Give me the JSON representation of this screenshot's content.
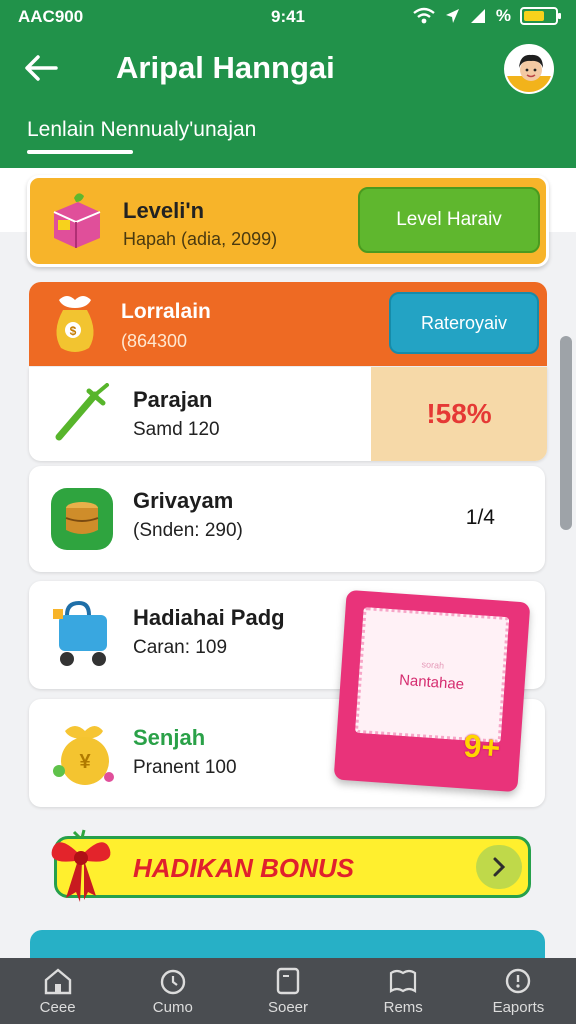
{
  "status_bar": {
    "carrier": "AAC900",
    "time": "9:41",
    "battery_pct": "%"
  },
  "header": {
    "title": "Aripal Hanngai",
    "subtab": "Lenlain Nennualy'unajan"
  },
  "level_card": {
    "title": "Leveli'n",
    "subtitle": "Hapah (adia, 2099)",
    "button": "Level Haraiv"
  },
  "orange_card": {
    "title": "Lorralain",
    "subtitle": "(864300",
    "button": "Rateroyaiv"
  },
  "rows": [
    {
      "title": "Parajan",
      "subtitle": "Samd 120",
      "badge": "!58%"
    },
    {
      "title": "Grivayam",
      "subtitle": "(Snden: 290)",
      "value": "1/4"
    },
    {
      "title": "Hadiahai Padg",
      "subtitle": "Caran: 109"
    },
    {
      "title": "Senjah",
      "subtitle": "Pranent 100"
    }
  ],
  "gift_card": {
    "label": "Nantahae",
    "small": "sorah",
    "badge": "9+"
  },
  "bonus": {
    "label": "HADIKAN BONUS"
  },
  "tabs": [
    {
      "label": "Ceee",
      "icon": "home-icon"
    },
    {
      "label": "Cumo",
      "icon": "clock-icon"
    },
    {
      "label": "Soeer",
      "icon": "card-icon"
    },
    {
      "label": "Rems",
      "icon": "map-icon"
    },
    {
      "label": "Eaports",
      "icon": "info-icon"
    }
  ],
  "colors": {
    "header": "#21924a",
    "accent_orange": "#ee6a23",
    "level_yellow": "#f7b42a",
    "bonus_yellow": "#ffef2e",
    "tabbar": "#4a4d51"
  }
}
